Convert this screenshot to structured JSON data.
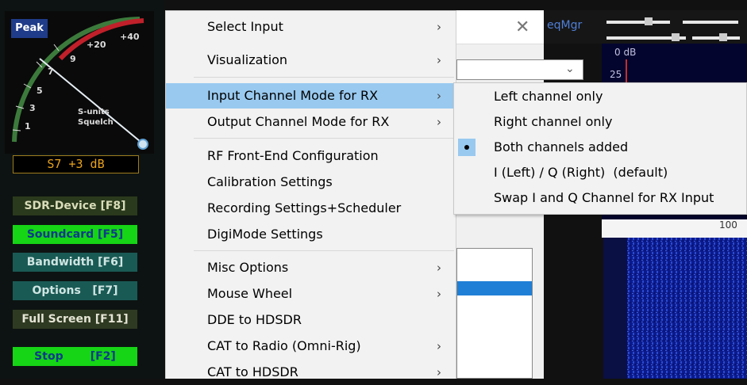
{
  "meter": {
    "peak_label": "Peak",
    "reading": "S7 +3 dB",
    "scale_labels": [
      "+40",
      "+20",
      "9",
      "7",
      "5",
      "3",
      "1"
    ],
    "text_s_units": "S-units",
    "text_squelch": "Squelch"
  },
  "left_buttons": [
    {
      "label": "SDR-Device [F8]",
      "color": "#2a3a1c"
    },
    {
      "label": "Soundcard [F5]",
      "color": "#16d416"
    },
    {
      "label": "Bandwidth [F6]",
      "color": "#1a5a55"
    },
    {
      "label": "Options   [F7]",
      "color": "#1a5a55"
    },
    {
      "label": "Full Screen [F11]",
      "color": "#2f3a22"
    },
    {
      "label": "Stop       [F2]",
      "color": "#16d416"
    }
  ],
  "menu": {
    "items": [
      {
        "label": "Select Input",
        "submenu": true
      },
      {
        "label": "Visualization",
        "submenu": true
      },
      {
        "label": "Input Channel Mode for RX",
        "submenu": true,
        "highlighted": true
      },
      {
        "label": "Output Channel Mode for RX",
        "submenu": true
      },
      {
        "label": "RF Front-End Configuration",
        "submenu": false
      },
      {
        "label": "Calibration Settings",
        "submenu": false
      },
      {
        "label": "Recording Settings+Scheduler",
        "submenu": false
      },
      {
        "label": "DigiMode Settings",
        "submenu": false
      },
      {
        "label": "Misc Options",
        "submenu": true
      },
      {
        "label": "Mouse Wheel",
        "submenu": true
      },
      {
        "label": "DDE to HDSDR",
        "submenu": false
      },
      {
        "label": "CAT to Radio (Omni-Rig)",
        "submenu": true
      },
      {
        "label": "CAT to HDSDR",
        "submenu": true
      }
    ],
    "arrow_glyph": "›"
  },
  "submenu": {
    "items": [
      {
        "label": "Left channel only",
        "checked": false
      },
      {
        "label": "Right channel only",
        "checked": false
      },
      {
        "label": "Both channels added",
        "checked": true
      },
      {
        "label": "I (Left) / Q (Right)  (default)",
        "checked": false
      },
      {
        "label": "Swap I and Q Channel for RX Input",
        "checked": false
      }
    ]
  },
  "behind": {
    "freqmgr_label": "eqMgr",
    "close_glyph": "✕",
    "spectrum_top_label": "0 dB",
    "spectrum_scale_label": "25",
    "waterfall_axis_label": "100"
  },
  "colors": {
    "menu_highlight": "#99c9ef",
    "menu_bg": "#f2f2f2",
    "waterfall_blue": "#0c1a8a"
  }
}
